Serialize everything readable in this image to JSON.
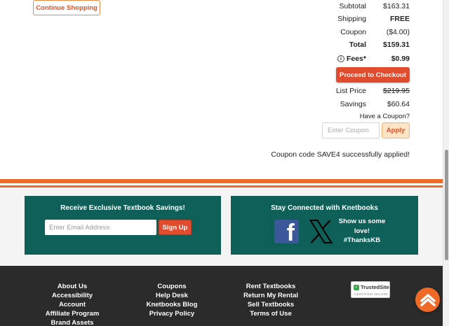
{
  "cart": {
    "continue_label": "Continue Shopping"
  },
  "summary": {
    "subtotal_label": "Subtotal",
    "subtotal_value": "$163.31",
    "shipping_label": "Shipping",
    "shipping_value": "FREE",
    "coupon_label": "Coupon",
    "coupon_value": "($4.00)",
    "total_label": "Total",
    "total_value": "$159.31",
    "fees_label": "Fees*",
    "fees_value": "$0.99",
    "checkout_label": "Proceed to Checkout",
    "list_price_label": "List Price",
    "list_price_value": "$219.95",
    "savings_label": "Savings",
    "savings_value": "$60.64"
  },
  "coupon_form": {
    "question": "Have a Coupon?",
    "placeholder": "Enter Coupon",
    "apply_label": "Apply",
    "success_message": "Coupon code SAVE4 successfully applied!"
  },
  "newsletter": {
    "title": "Receive Exclusive Textbook Savings!",
    "placeholder": "Enter Email Address",
    "signup_label": "Sign Up"
  },
  "social": {
    "title": "Stay Connected with Knetbooks",
    "message_line1": "Show us some",
    "message_line2": "love!",
    "hashtag": "#ThanksKB"
  },
  "footer": {
    "col1": [
      "About Us",
      "Accessibility",
      "Account",
      "Affiliate Program",
      "Brand Assets"
    ],
    "col2": [
      "Coupons",
      "Help Desk",
      "Knetbooks Blog",
      "Privacy Policy"
    ],
    "col3": [
      "Rent Textbooks",
      "Return My Rental",
      "Sell Textbooks",
      "Terms of Use"
    ]
  },
  "trusted_site": {
    "name": "TrustedSite",
    "sub": "CERTIFIED SECURE"
  },
  "colors": {
    "brand_orange": "#ef6a26",
    "cta_red": "#e14b2e",
    "teal": "#0e5f57",
    "footer_bg": "#2b2b2b"
  },
  "icons": {
    "facebook": "facebook-icon",
    "x": "x-icon",
    "info": "info-icon",
    "scroll_top": "chevron-up-icon"
  }
}
